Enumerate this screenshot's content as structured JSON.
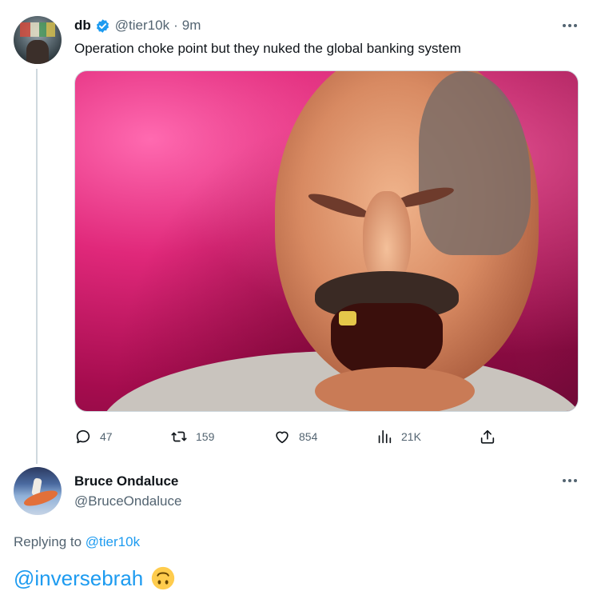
{
  "tweet": {
    "author_name": "db",
    "author_handle": "@tier10k",
    "separator": "·",
    "time": "9m",
    "text": "Operation choke point but they nuked the global banking system",
    "media_description": "photo",
    "actions": {
      "replies": "47",
      "retweets": "159",
      "likes": "854",
      "views": "21K"
    },
    "icons": {
      "verified": "verified-badge-icon",
      "more": "more-icon",
      "reply": "reply-icon",
      "retweet": "retweet-icon",
      "like": "heart-icon",
      "views": "views-icon",
      "share": "share-icon"
    }
  },
  "reply": {
    "author_name": "Bruce Ondaluce",
    "author_handle": "@BruceOndaluce",
    "replying_prefix": "Replying to",
    "replying_handle": "@tier10k",
    "text_mention": "@inversebrah",
    "emoji": "upside-down-face"
  },
  "colors": {
    "accent": "#1d9bf0",
    "text_primary": "#0f1419",
    "text_secondary": "#536471",
    "divider": "#cfd9de"
  }
}
